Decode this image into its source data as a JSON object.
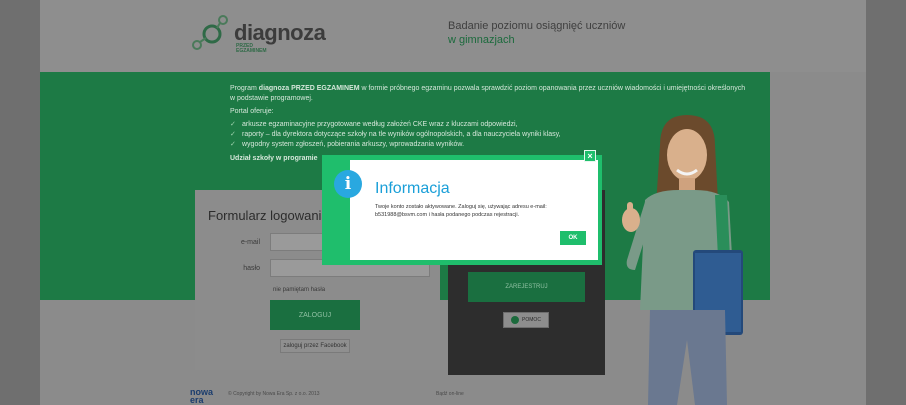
{
  "header": {
    "logo_text": "diagnoza",
    "logo_sub_line1": "PRZED",
    "logo_sub_line2": "EGZAMINEM",
    "tagline_line1": "Badanie poziomu osiągnięć uczniów",
    "tagline_line2": "w gimnazjach"
  },
  "band": {
    "intro_prefix": "Program ",
    "intro_strong": "diagnoza PRZED EGZAMINEM",
    "intro_rest": " w formie próbnego egzaminu pozwala sprawdzić poziom opanowania przez uczniów wiadomości i umiejętności określonych w podstawie programowej.",
    "offer_title": "Portal oferuje:",
    "items": [
      "arkusze egzaminacyjne przygotowane według założeń CKE wraz z kluczami odpowiedzi,",
      "raporty – dla dyrektora dotyczące szkoły na tle wyników ogólnopolskich, a dla nauczyciela wyniki klasy,",
      "wygodny system zgłoszeń, pobierania arkuszy, wprowadzania wyników."
    ],
    "cta": "Udział szkoły w programie"
  },
  "login": {
    "title": "Formularz logowania",
    "email_label": "e-mail",
    "password_label": "hasło",
    "forgot": "nie pamiętam hasła",
    "submit": "ZALOGUJ",
    "facebook": "zaloguj przez Facebook"
  },
  "register": {
    "button": "ZAREJESTRUJ",
    "help": "POMOC"
  },
  "footer": {
    "logo_line1": "nowa",
    "logo_line2": "era",
    "copy_line1": "© Copyright by Nowa Era Sp. z o.o. 2013",
    "right": "Bądź on-line"
  },
  "modal": {
    "title": "Informacja",
    "message": "Twoje konto zostało aktywowane. Zaloguj się, używając adresu e-mail: b531988@bsvm.com i hasła podanego podczas rejestracji.",
    "ok": "OK",
    "close": "×"
  },
  "colors": {
    "brand_green": "#1d7a45",
    "modal_green": "#1fbe6c",
    "info_blue": "#29a8e0"
  }
}
